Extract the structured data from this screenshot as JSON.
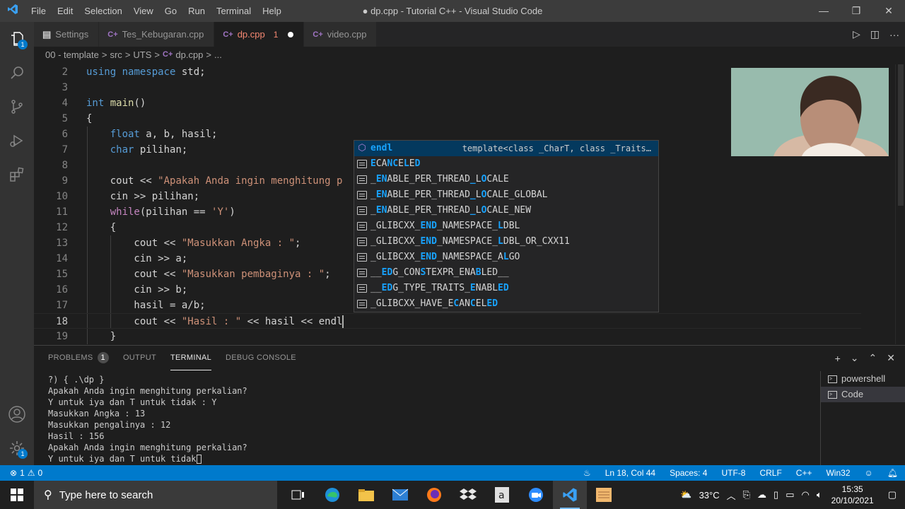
{
  "window": {
    "title": "● dp.cpp - Tutorial C++ - Visual Studio Code",
    "menu": [
      "File",
      "Edit",
      "Selection",
      "View",
      "Go",
      "Run",
      "Terminal",
      "Help"
    ],
    "controls": {
      "minimize": "—",
      "restore": "❐",
      "close": "✕"
    }
  },
  "activity_bar": {
    "explorer_badge": "1"
  },
  "tabs": [
    {
      "label": "Settings",
      "icon": "gear-icon"
    },
    {
      "label": "Tes_Kebugaran.cpp",
      "icon": "cpp-file-icon"
    },
    {
      "label": "dp.cpp",
      "icon": "cpp-file-icon",
      "problems": "1",
      "modified": true,
      "active": true
    },
    {
      "label": "video.cpp",
      "icon": "cpp-file-icon"
    }
  ],
  "breadcrumb": {
    "parts": [
      "00 - template",
      "src",
      "UTS",
      "dp.cpp",
      "..."
    ],
    "separator": ">"
  },
  "editor": {
    "current_line": 18,
    "lines": [
      {
        "n": "2",
        "tokens": [
          [
            "kw",
            "using"
          ],
          [
            "",
            " "
          ],
          [
            "kw",
            "namespace"
          ],
          [
            "",
            " std;"
          ]
        ]
      },
      {
        "n": "3",
        "tokens": []
      },
      {
        "n": "4",
        "tokens": [
          [
            "kw",
            "int"
          ],
          [
            "",
            " "
          ],
          [
            "fn",
            "main"
          ],
          [
            "",
            "()"
          ]
        ]
      },
      {
        "n": "5",
        "tokens": [
          [
            "",
            "{"
          ]
        ]
      },
      {
        "n": "6",
        "tokens": [
          [
            "",
            "    "
          ],
          [
            "kw",
            "float"
          ],
          [
            "",
            " a, b, hasil;"
          ]
        ]
      },
      {
        "n": "7",
        "tokens": [
          [
            "",
            "    "
          ],
          [
            "kw",
            "char"
          ],
          [
            "",
            " pilihan;"
          ]
        ]
      },
      {
        "n": "8",
        "tokens": []
      },
      {
        "n": "9",
        "tokens": [
          [
            "",
            "    cout << "
          ],
          [
            "str",
            "\"Apakah Anda ingin menghitung p"
          ]
        ]
      },
      {
        "n": "10",
        "tokens": [
          [
            "",
            "    cin >> pilihan;"
          ]
        ]
      },
      {
        "n": "11",
        "tokens": [
          [
            "",
            "    "
          ],
          [
            "ctl",
            "while"
          ],
          [
            "",
            "(pilihan == "
          ],
          [
            "str",
            "'Y'"
          ],
          [
            "",
            ")"
          ]
        ]
      },
      {
        "n": "12",
        "tokens": [
          [
            "",
            "    {"
          ]
        ]
      },
      {
        "n": "13",
        "tokens": [
          [
            "",
            "        cout << "
          ],
          [
            "str",
            "\"Masukkan Angka : \""
          ],
          [
            "",
            ";"
          ]
        ]
      },
      {
        "n": "14",
        "tokens": [
          [
            "",
            "        cin >> a;"
          ]
        ]
      },
      {
        "n": "15",
        "tokens": [
          [
            "",
            "        cout << "
          ],
          [
            "str",
            "\"Masukkan pembaginya : \""
          ],
          [
            "",
            ";"
          ]
        ]
      },
      {
        "n": "16",
        "tokens": [
          [
            "",
            "        cin >> b;"
          ]
        ]
      },
      {
        "n": "17",
        "tokens": [
          [
            "",
            "        hasil = a/b;"
          ]
        ]
      },
      {
        "n": "18",
        "tokens": [
          [
            "",
            "        cout << "
          ],
          [
            "str",
            "\"Hasil : \""
          ],
          [
            "",
            " << hasil << endl"
          ]
        ]
      },
      {
        "n": "19",
        "tokens": [
          [
            "",
            "    }"
          ]
        ]
      }
    ]
  },
  "suggestions": [
    {
      "label": "endl",
      "kind": "cube",
      "detail": "template<class _CharT, class _Traits…",
      "selected": true,
      "hl": [
        0,
        1,
        2,
        3
      ]
    },
    {
      "label": "ECANCELED",
      "kind": "list",
      "hl": [
        0,
        3,
        4,
        6,
        8
      ]
    },
    {
      "label": "_ENABLE_PER_THREAD_LOCALE",
      "kind": "list",
      "hl": [
        1,
        2,
        18,
        20
      ]
    },
    {
      "label": "_ENABLE_PER_THREAD_LOCALE_GLOBAL",
      "kind": "list",
      "hl": [
        1,
        2,
        18,
        20
      ]
    },
    {
      "label": "_ENABLE_PER_THREAD_LOCALE_NEW",
      "kind": "list",
      "hl": [
        1,
        2,
        18,
        20
      ]
    },
    {
      "label": "_GLIBCXX_END_NAMESPACE_LDBL",
      "kind": "list",
      "hl": [
        9,
        10,
        11,
        23
      ]
    },
    {
      "label": "_GLIBCXX_END_NAMESPACE_LDBL_OR_CXX11",
      "kind": "list",
      "hl": [
        9,
        10,
        11,
        23
      ]
    },
    {
      "label": "_GLIBCXX_END_NAMESPACE_ALGO",
      "kind": "list",
      "hl": [
        9,
        10,
        11,
        24
      ]
    },
    {
      "label": "__EDG_CONSTEXPR_ENABLED__",
      "kind": "list",
      "hl": [
        2,
        3,
        9,
        19
      ]
    },
    {
      "label": "__EDG_TYPE_TRAITS_ENABLED",
      "kind": "list",
      "hl": [
        2,
        3,
        18,
        23,
        24
      ]
    },
    {
      "label": "_GLIBCXX_HAVE_ECANCELED",
      "kind": "list",
      "hl": [
        15,
        18,
        21,
        22
      ]
    }
  ],
  "panel": {
    "tabs": [
      {
        "label": "PROBLEMS",
        "badge": "1"
      },
      {
        "label": "OUTPUT"
      },
      {
        "label": "TERMINAL",
        "active": true
      },
      {
        "label": "DEBUG CONSOLE"
      }
    ],
    "terminal_lines": [
      "?) { .\\dp }",
      "Apakah Anda ingin menghitung perkalian?",
      "Y untuk iya dan T untuk tidak : Y",
      "Masukkan Angka : 13",
      "Masukkan pengalinya : 12",
      "Hasil : 156",
      "Apakah Anda ingin menghitung perkalian?",
      "Y untuk iya dan T untuk tidak"
    ],
    "terminal_list": [
      {
        "label": "powershell"
      },
      {
        "label": "Code",
        "selected": true
      }
    ]
  },
  "status": {
    "errors": "1",
    "warnings": "0",
    "position": "Ln 18, Col 44",
    "spaces": "Spaces: 4",
    "encoding": "UTF-8",
    "eol": "CRLF",
    "language": "C++",
    "platform": "Win32"
  },
  "taskbar": {
    "search_placeholder": "Type here to search",
    "temperature": "33°C",
    "time": "15:35",
    "date": "20/10/2021"
  }
}
